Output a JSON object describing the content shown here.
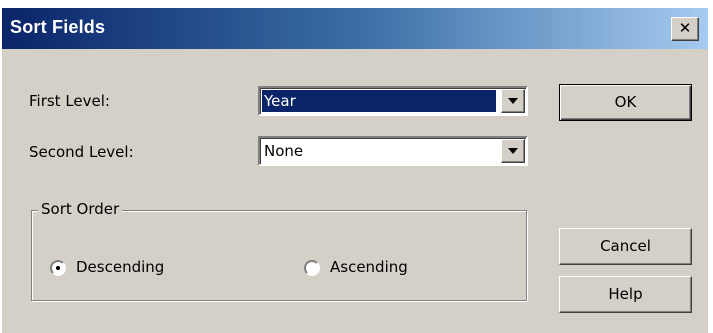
{
  "window": {
    "title": "Sort Fields",
    "close_glyph": "✕",
    "titlebar_gradient": [
      "#0a246a",
      "#a6caf0"
    ],
    "background": "#d4d0c8"
  },
  "fields": {
    "first_level": {
      "label": "First Level:",
      "value": "Year"
    },
    "second_level": {
      "label": "Second Level:",
      "value": "None"
    }
  },
  "sort_order": {
    "legend": "Sort Order",
    "options": [
      {
        "label": "Descending",
        "selected": true
      },
      {
        "label": "Ascending",
        "selected": false
      }
    ]
  },
  "buttons": {
    "ok": "OK",
    "cancel": "Cancel",
    "help": "Help"
  },
  "icons": {
    "close": "close-icon",
    "dropdown": "chevron-down-icon"
  },
  "colors": {
    "selection": "#0a246a",
    "face": "#d4d0c8"
  }
}
